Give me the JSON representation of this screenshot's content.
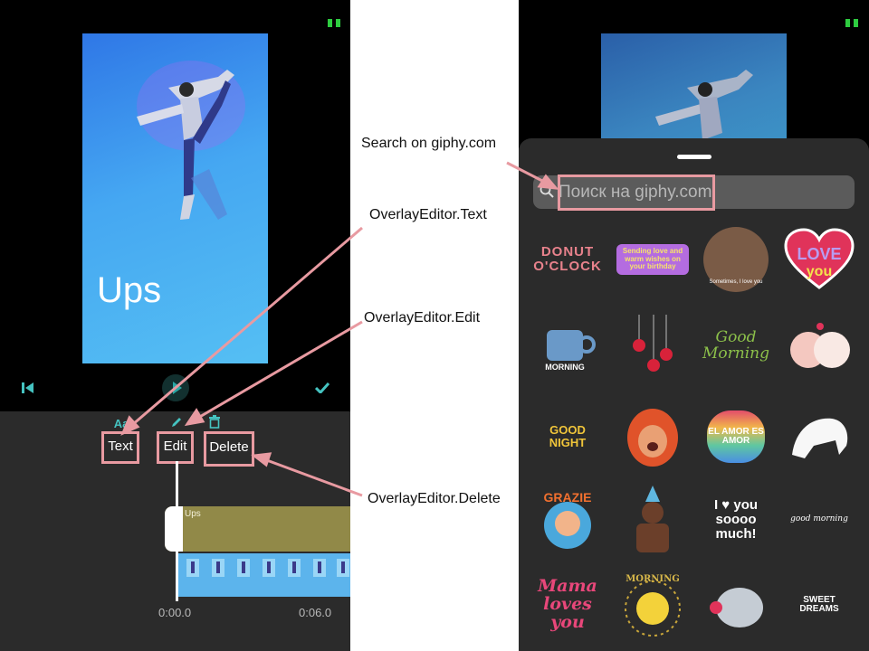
{
  "left": {
    "overlay_text": "Ups",
    "tools": [
      {
        "icon": "Aa",
        "label": "Text"
      },
      {
        "icon": "pencil",
        "label": "Edit"
      },
      {
        "icon": "trash",
        "label": "Delete"
      }
    ],
    "track_label": "Ups",
    "time_start": "0:00.0",
    "time_end": "0:06.0"
  },
  "annotations": {
    "search": "Search on giphy.com",
    "text": "OverlayEditor.Text",
    "edit": "OverlayEditor.Edit",
    "delete": "OverlayEditor.Delete"
  },
  "right": {
    "search_placeholder": "Поиск на giphy.com",
    "stickers": [
      {
        "text": "DONUT O'CLOCK",
        "icon": "donut-oclock-sticker"
      },
      {
        "text": "Sending love and warm wishes on your birthday",
        "icon": "birthday-balloons-sticker"
      },
      {
        "text": "Sometimes, I love you",
        "icon": "woman-sticker"
      },
      {
        "text": "LOVE you",
        "icon": "love-heart-sticker"
      },
      {
        "text": "MORNING",
        "icon": "coffee-cup-sticker"
      },
      {
        "text": "",
        "icon": "hanging-hearts-sticker"
      },
      {
        "text": "Good Morning",
        "icon": "good-morning-flower-sticker"
      },
      {
        "text": "",
        "icon": "pigs-kiss-sticker"
      },
      {
        "text": "GOOD NIGHT",
        "icon": "good-night-sticker"
      },
      {
        "text": "",
        "icon": "elmo-baby-sticker"
      },
      {
        "text": "EL AMOR ES AMOR",
        "icon": "el-amor-heart-sticker"
      },
      {
        "text": "",
        "icon": "sloth-sticker"
      },
      {
        "text": "GRAZIE",
        "icon": "grazie-boy-sticker"
      },
      {
        "text": "",
        "icon": "party-man-sticker"
      },
      {
        "text": "I ♥ you soooo much!",
        "icon": "love-you-so-much-sticker"
      },
      {
        "text": "good morning",
        "icon": "good-morning-daisy-sticker"
      },
      {
        "text": "Mama loves you",
        "icon": "mama-loves-you-sticker"
      },
      {
        "text": "GOOD MORNING",
        "icon": "sun-good-morning-sticker"
      },
      {
        "text": "",
        "icon": "elephant-sticker"
      },
      {
        "text": "SWEET DREAMS",
        "icon": "sweet-dreams-sticker"
      }
    ]
  },
  "colors": {
    "accent": "#45c3c1",
    "highlight": "#e89aa1",
    "track": "#918948",
    "sheet": "#2b2b2b"
  }
}
